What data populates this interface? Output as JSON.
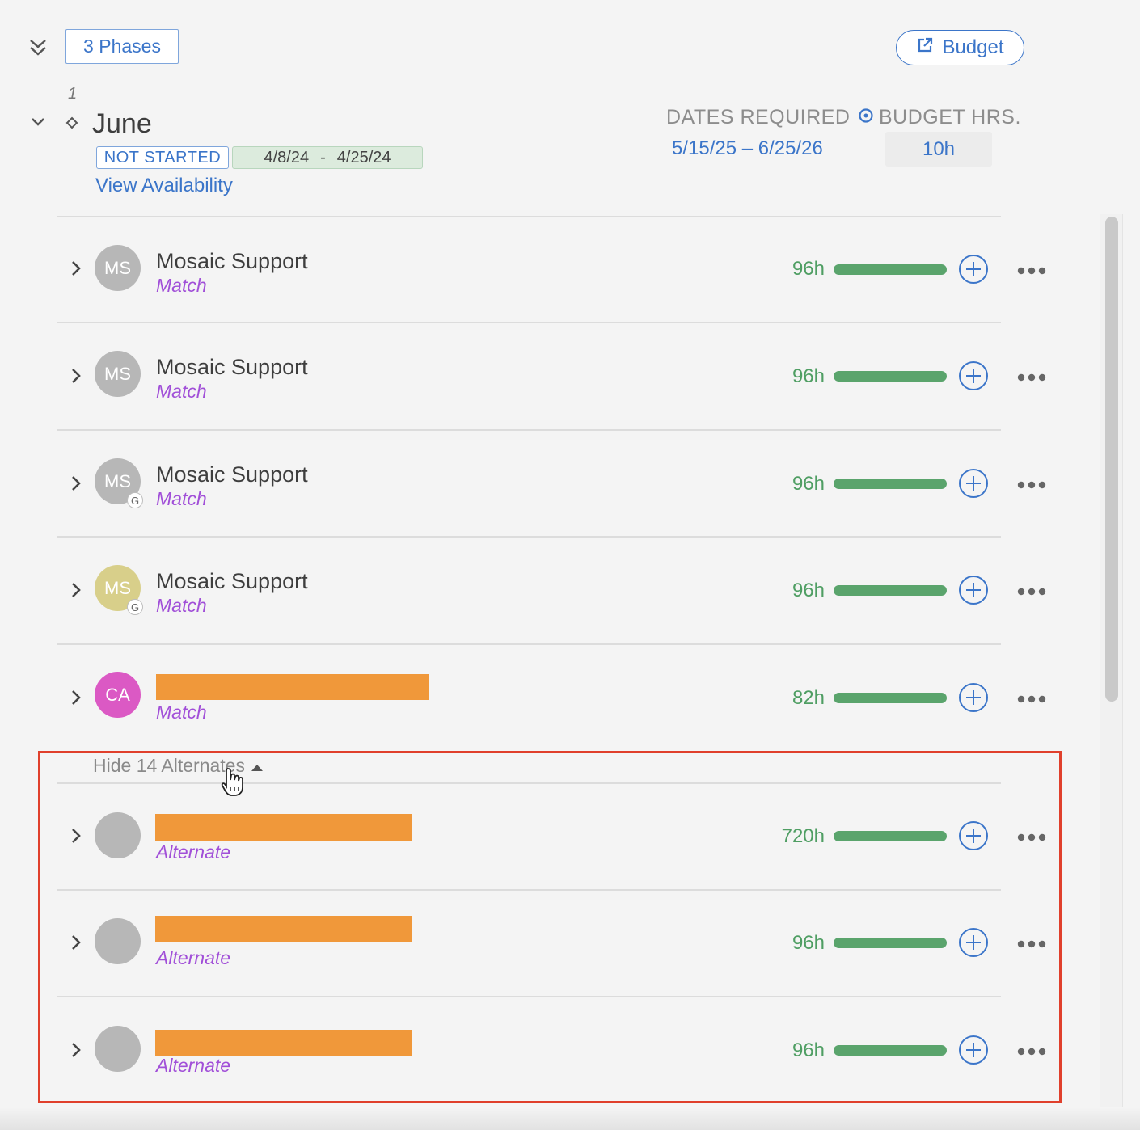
{
  "toolbar": {
    "phases_label": "3 Phases",
    "budget_label": "Budget"
  },
  "phase": {
    "number": "1",
    "title": "June",
    "status": "NOT STARTED",
    "date_start": "4/8/24",
    "date_sep": "-",
    "date_end": "4/25/24",
    "view_availability": "View Availability",
    "dates_required_label": "DATES REQUIRED",
    "dates_required_value": "5/15/25 – 6/25/26",
    "budget_hrs_label": "BUDGET HRS.",
    "budget_hrs_value": "10h"
  },
  "rows": [
    {
      "initials": "MS",
      "name": "Mosaic Support",
      "type": "Match",
      "hours": "96h",
      "avatar_color": "#b7b7b7",
      "badge": ""
    },
    {
      "initials": "MS",
      "name": "Mosaic Support",
      "type": "Match",
      "hours": "96h",
      "avatar_color": "#b7b7b7",
      "badge": ""
    },
    {
      "initials": "MS",
      "name": "Mosaic Support",
      "type": "Match",
      "hours": "96h",
      "avatar_color": "#b7b7b7",
      "badge": "G"
    },
    {
      "initials": "MS",
      "name": "Mosaic Support",
      "type": "Match",
      "hours": "96h",
      "avatar_color": "#d8cf8a",
      "badge": "G"
    },
    {
      "initials": "CA",
      "name": "",
      "type": "Match",
      "hours": "82h",
      "avatar_color": "#db59c4",
      "badge": ""
    }
  ],
  "alternates": {
    "toggle_label": "Hide 14 Alternates",
    "rows": [
      {
        "type": "Alternate",
        "hours": "720h",
        "avatar_color": "#b7b7b7"
      },
      {
        "type": "Alternate",
        "hours": "96h",
        "avatar_color": "#b7b7b7"
      },
      {
        "type": "Alternate",
        "hours": "96h",
        "avatar_color": "#b7b7b7"
      }
    ]
  },
  "colors": {
    "accent": "#3b75c9",
    "hours_green": "#4f9e63",
    "sub_purple": "#a14fd8",
    "redaction": "#f0983a",
    "highlight": "#e0402c"
  }
}
